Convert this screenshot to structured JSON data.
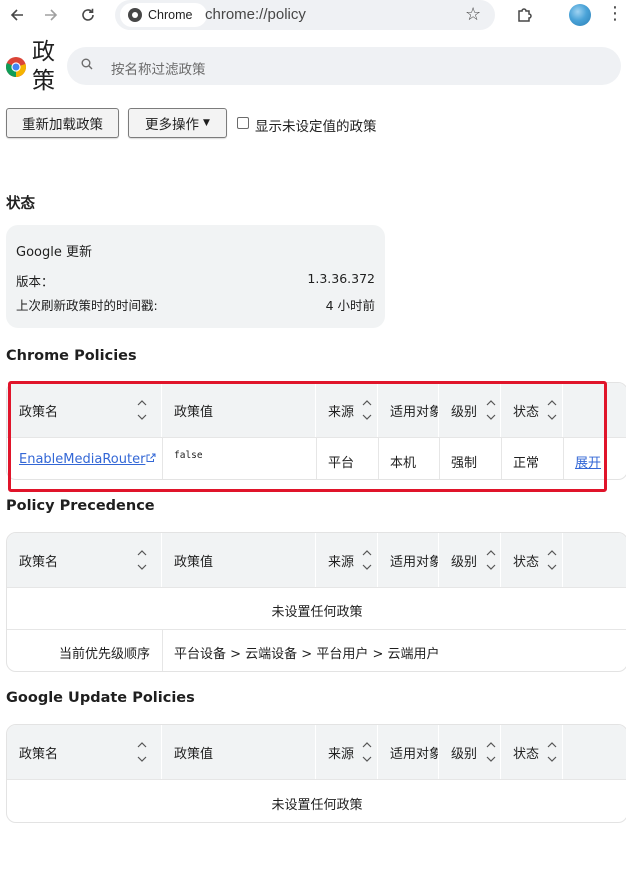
{
  "browser": {
    "chip_label": "Chrome",
    "url": "chrome://policy"
  },
  "page": {
    "title": "政策",
    "search_placeholder": "按名称过滤政策",
    "reload_button": "重新加载政策",
    "more_actions_button": "更多操作",
    "show_unset_label": "显示未设定值的政策",
    "show_unset_checked": false
  },
  "status": {
    "heading": "状态",
    "box_title": "Google 更新",
    "version_label": "版本：",
    "version_value": "1.3.36.372",
    "last_fetch_label": "上次刷新政策时的时间戳:",
    "last_fetch_value": "4 小时前"
  },
  "columns": {
    "name": "政策名",
    "value": "政策值",
    "source": "来源",
    "scope": "适用对象",
    "level": "级别",
    "status": "状态"
  },
  "chrome_policies": {
    "heading": "Chrome Policies",
    "rows": [
      {
        "name": "EnableMediaRouter",
        "value": "false",
        "source": "平台",
        "scope": "本机",
        "level": "强制",
        "status": "正常",
        "action": "展开"
      }
    ]
  },
  "policy_precedence": {
    "heading": "Policy Precedence",
    "empty_text": "未设置任何政策",
    "order_label": "当前优先级顺序",
    "order_value": "平台设备 > 云端设备 > 平台用户 > 云端用户"
  },
  "google_update_policies": {
    "heading": "Google Update Policies",
    "empty_text": "未设置任何政策"
  },
  "colors": {
    "accent_link": "#3367d6",
    "highlight_border": "#e0142a",
    "header_bg": "#f1f3f4"
  }
}
